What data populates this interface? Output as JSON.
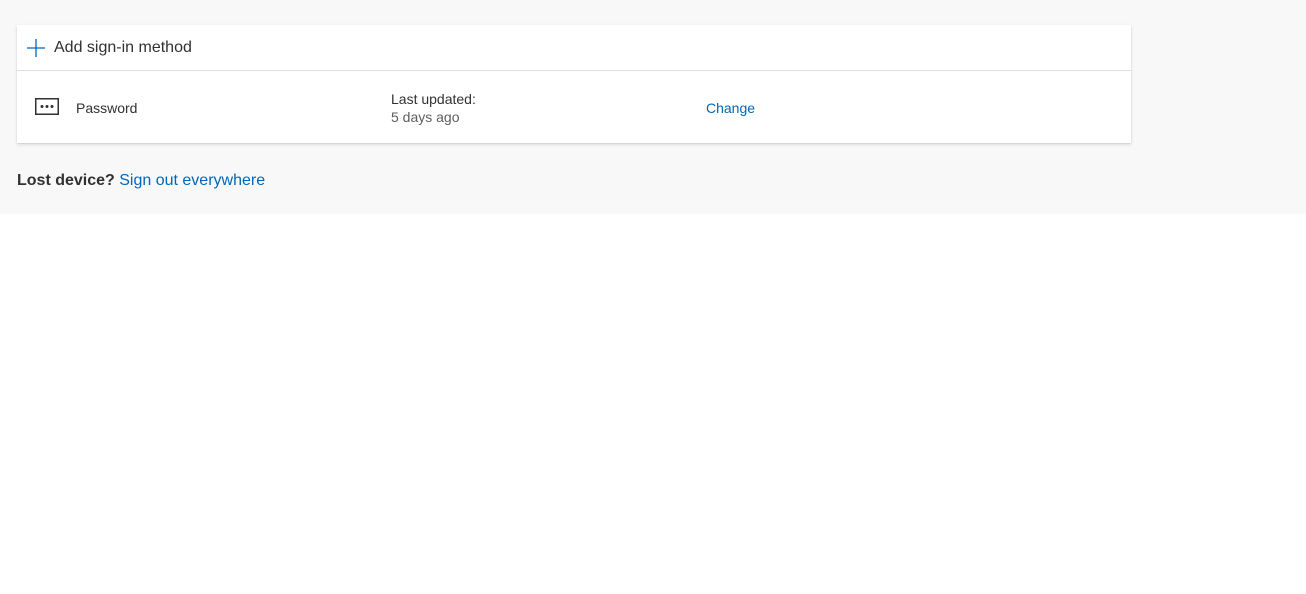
{
  "sign_in_methods": {
    "add_label": "Add sign-in method",
    "methods": [
      {
        "icon": "password-icon",
        "name": "Password",
        "updated_label": "Last updated:",
        "updated_value": "5 days ago",
        "action_label": "Change"
      }
    ]
  },
  "lost_device": {
    "label": "Lost device?",
    "link_text": "Sign out everywhere"
  },
  "colors": {
    "accent": "#0067b8",
    "page_background": "#f8f8f8",
    "card_background": "#ffffff",
    "text": "#323130"
  }
}
